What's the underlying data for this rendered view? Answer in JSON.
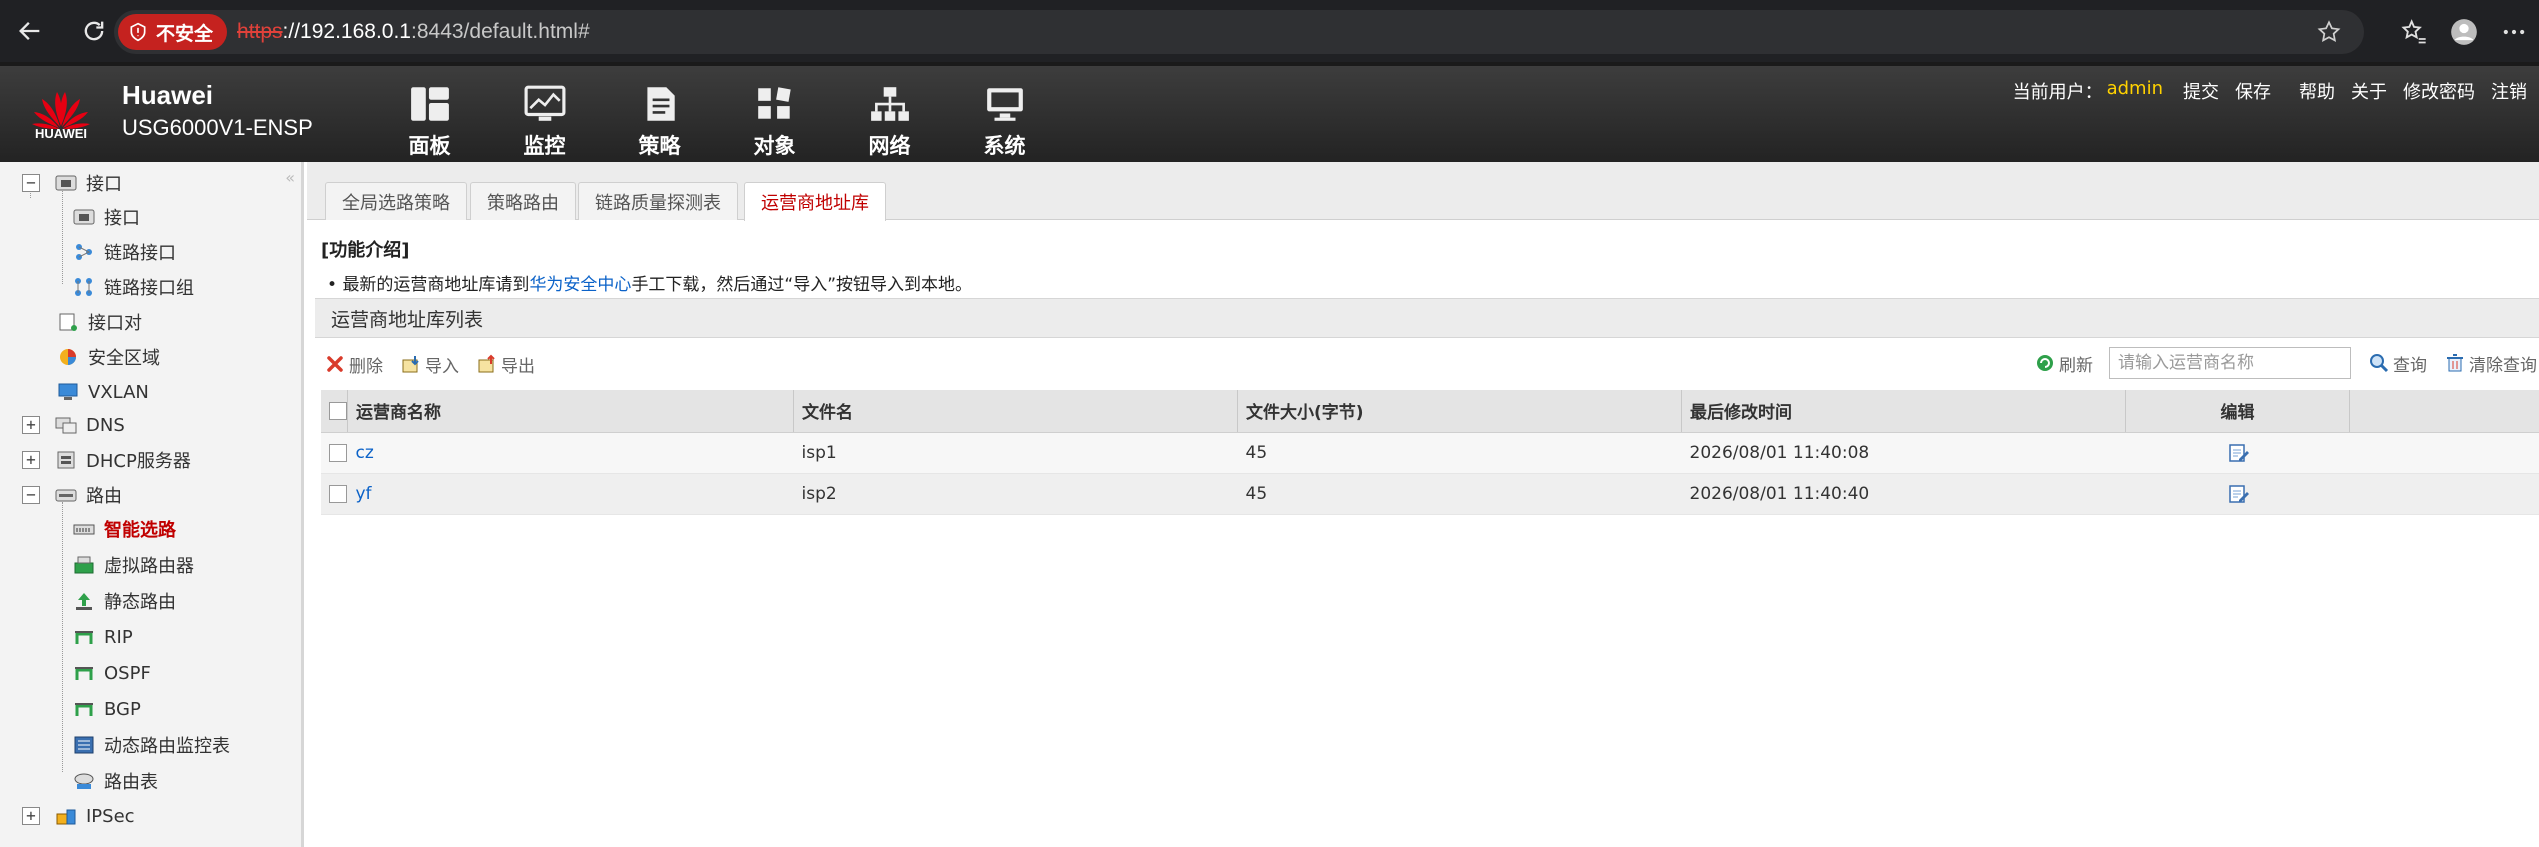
{
  "browser": {
    "insecure_label": "不安全",
    "url_scheme": "https",
    "url_host": "://192.168.0.1",
    "url_rest": ":8443/default.html#"
  },
  "header": {
    "logo_text": "HUAWEI",
    "brand_name": "Huawei",
    "model": "USG6000V1-ENSP",
    "nav": [
      {
        "label": "面板",
        "icon": "dashboard-icon"
      },
      {
        "label": "监控",
        "icon": "monitor-icon"
      },
      {
        "label": "策略",
        "icon": "policy-icon"
      },
      {
        "label": "对象",
        "icon": "object-icon"
      },
      {
        "label": "网络",
        "icon": "network-icon"
      },
      {
        "label": "系统",
        "icon": "system-icon"
      }
    ],
    "user_prefix": "当前用户：",
    "user_name": "admin",
    "links": [
      "提交",
      "保存",
      "帮助",
      "关于",
      "修改密码",
      "注销"
    ]
  },
  "sidebar": {
    "items": [
      {
        "label": "接口",
        "icon": "interface-icon"
      },
      {
        "label": "接口",
        "icon": "interface-icon"
      },
      {
        "label": "链路接口",
        "icon": "link-interface-icon"
      },
      {
        "label": "链路接口组",
        "icon": "link-group-icon"
      },
      {
        "label": "接口对",
        "icon": "interface-pair-icon"
      },
      {
        "label": "安全区域",
        "icon": "security-zone-icon"
      },
      {
        "label": "VXLAN",
        "icon": "vxlan-icon"
      },
      {
        "label": "DNS",
        "icon": "dns-icon"
      },
      {
        "label": "DHCP服务器",
        "icon": "dhcp-icon"
      },
      {
        "label": "路由",
        "icon": "route-icon"
      },
      {
        "label": "智能选路",
        "icon": "smart-routing-icon"
      },
      {
        "label": "虚拟路由器",
        "icon": "virtual-router-icon"
      },
      {
        "label": "静态路由",
        "icon": "static-route-icon"
      },
      {
        "label": "RIP",
        "icon": "rip-icon"
      },
      {
        "label": "OSPF",
        "icon": "ospf-icon"
      },
      {
        "label": "BGP",
        "icon": "bgp-icon"
      },
      {
        "label": "动态路由监控表",
        "icon": "dynamic-route-monitor-icon"
      },
      {
        "label": "路由表",
        "icon": "route-table-icon"
      },
      {
        "label": "IPSec",
        "icon": "ipsec-icon"
      }
    ]
  },
  "tabs": [
    "全局选路策略",
    "策略路由",
    "链路质量探测表",
    "运营商地址库"
  ],
  "intro": {
    "title": "[功能介绍]",
    "text_before": "最新的运营商地址库请到",
    "link_text": "华为安全中心",
    "text_after": "手工下载，然后通过“导入”按钮导入到本地。"
  },
  "panel": {
    "title": "运营商地址库列表",
    "delete_label": "删除",
    "import_label": "导入",
    "export_label": "导出",
    "refresh_label": "刷新",
    "search_placeholder": "请输入运营商名称",
    "query_label": "查询",
    "clear_label": "清除查询"
  },
  "table": {
    "headers": [
      "运营商名称",
      "文件名",
      "文件大小(字节)",
      "最后修改时间",
      "编辑"
    ],
    "rows": [
      {
        "name": "cz",
        "file": "isp1",
        "size": "45",
        "modified": "2026/08/01 11:40:08"
      },
      {
        "name": "yf",
        "file": "isp2",
        "size": "45",
        "modified": "2026/08/01 11:40:40"
      }
    ]
  }
}
